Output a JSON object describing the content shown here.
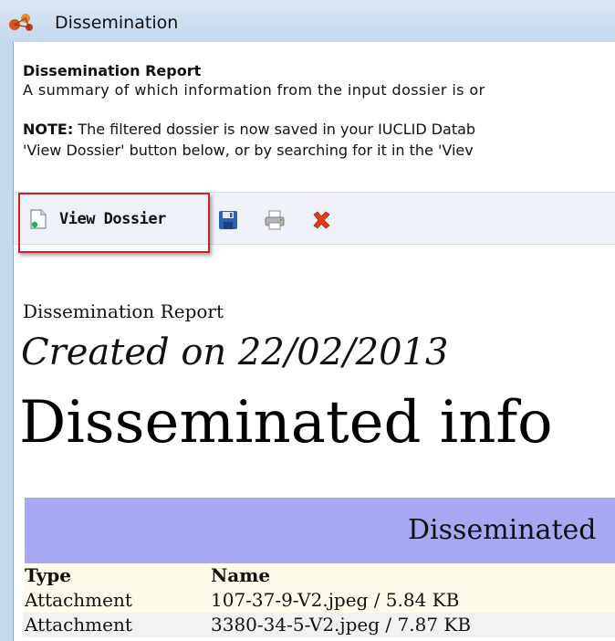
{
  "window": {
    "title": "Dissemination"
  },
  "header": {
    "heading": "Dissemination Report",
    "description": "A summary of which information from the input dossier is or",
    "note_label": "NOTE:",
    "note_line1": " The filtered dossier is now saved in your IUCLID Datab",
    "note_line2": "'View Dossier' button below, or by searching for it in the 'Viev"
  },
  "toolbar": {
    "view_dossier_label": "View Dossier",
    "icons": [
      "document-icon",
      "save-icon",
      "print-icon",
      "close-icon"
    ]
  },
  "report": {
    "small_title": "Dissemination Report",
    "created_on": "Created on 22/02/2013",
    "big_title": "Disseminated info",
    "banner_text": "Disseminated",
    "table": {
      "headers": [
        "Type",
        "Name"
      ],
      "rows": [
        {
          "type": "Attachment",
          "name": "107-37-9-V2.jpeg / 5.84 KB"
        },
        {
          "type": "Attachment",
          "name": "3380-34-5-V2.jpeg / 7.87 KB"
        }
      ]
    }
  },
  "colors": {
    "banner": "#a7a7f2",
    "highlight_border": "#c8262b",
    "toolbar_bg": "#eef2f8"
  }
}
